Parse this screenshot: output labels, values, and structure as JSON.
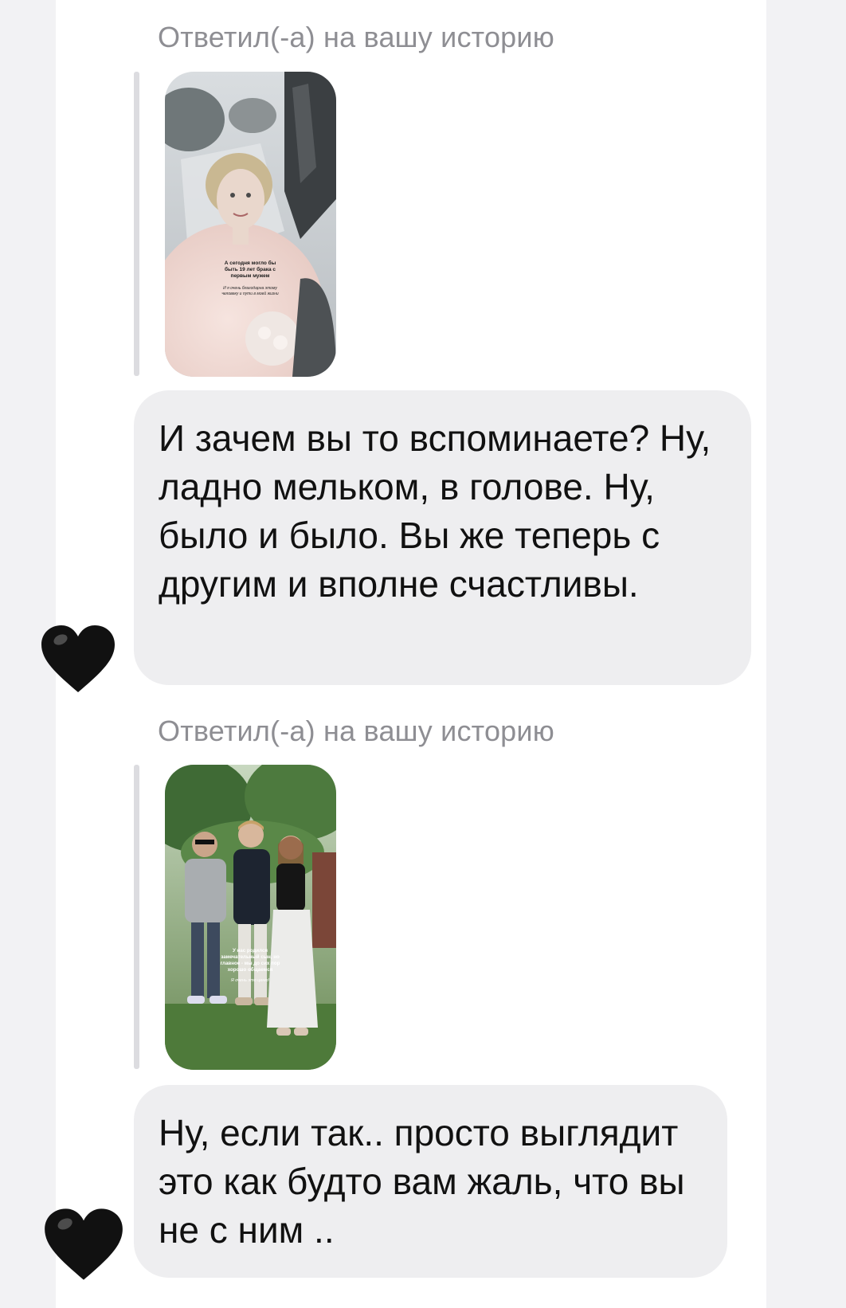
{
  "conversation": {
    "messages": [
      {
        "reply_label": "Ответил(-а) на вашу историю",
        "story": {
          "caption_main": [
            "А сегодня могло бы",
            "быть 19 лет брака с",
            "первым мужем"
          ],
          "caption_sub": [
            "И я очень благодарна этому",
            "человеку и пути в моей жизни"
          ]
        },
        "text": "И зачем вы то вспоминаете? Ну, ладно мельком, в голове. Ну, было и было. Вы же теперь с другим и вполне счастливы.",
        "reaction": "black-heart"
      },
      {
        "reply_label": "Ответил(-а) на вашу историю",
        "story": {
          "caption_main": [
            "У нас родился",
            "замечательный сын, но",
            "главное - мы до сих пор",
            "хорошо общаемся"
          ],
          "caption_sub": [
            "Я очень это ценю!"
          ]
        },
        "text": "Ну, если так.. просто выглядит это как будто вам жаль, что вы не с ним ..",
        "reaction": "black-heart"
      }
    ]
  },
  "colors": {
    "bubble": "#eeeef0",
    "label": "#8e8e93",
    "heart": "#111111"
  }
}
